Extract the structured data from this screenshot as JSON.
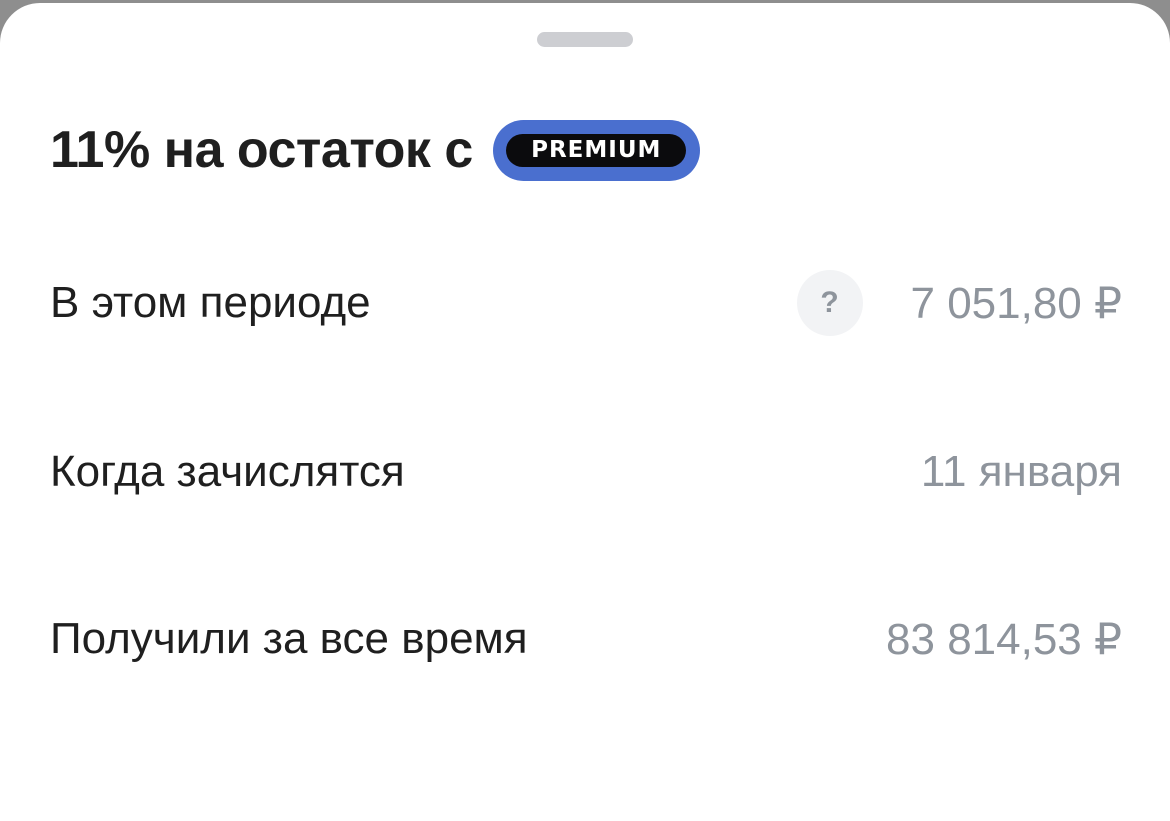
{
  "title": "11% на остаток с",
  "badge": "PREMIUM",
  "help_glyph": "?",
  "rows": [
    {
      "label": "В этом периоде",
      "value": "7 051,80 ₽"
    },
    {
      "label": "Когда зачислятся",
      "value": "11 января"
    },
    {
      "label": "Получили за все время",
      "value": "83 814,53 ₽"
    }
  ],
  "colors": {
    "badge_outer": "#4a6fcf",
    "badge_inner": "#0b0b0d",
    "value_text": "#8e949c",
    "label_text": "#1f1f1f"
  }
}
